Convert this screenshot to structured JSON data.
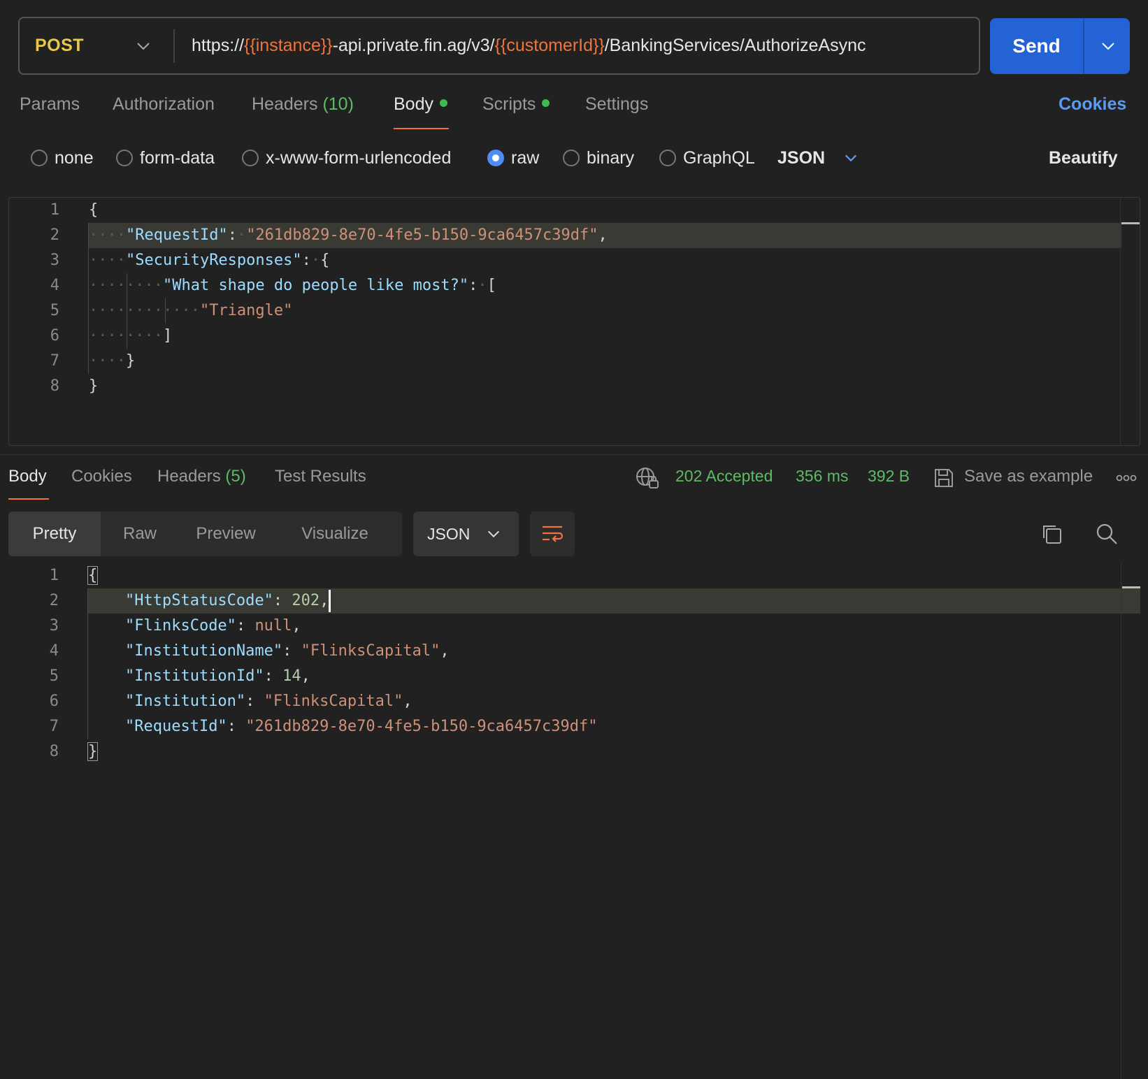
{
  "request": {
    "method": "POST",
    "url_parts": [
      {
        "text": "https://",
        "var": false
      },
      {
        "text": "{{instance}}",
        "var": true
      },
      {
        "text": "-api.private.fin.ag/v3/",
        "var": false
      },
      {
        "text": "{{customerId}}",
        "var": true
      },
      {
        "text": "/BankingServices/AuthorizeAsync",
        "var": false
      }
    ],
    "send_label": "Send"
  },
  "request_tabs": {
    "params": "Params",
    "authorization": "Authorization",
    "headers": "Headers",
    "headers_count": "(10)",
    "body": "Body",
    "scripts": "Scripts",
    "settings": "Settings",
    "cookies": "Cookies"
  },
  "body_types": {
    "none": "none",
    "form_data": "form-data",
    "urlencoded": "x-www-form-urlencoded",
    "raw": "raw",
    "binary": "binary",
    "graphql": "GraphQL",
    "format": "JSON",
    "beautify": "Beautify",
    "selected": "raw"
  },
  "request_body_lines": [
    "1",
    "2",
    "3",
    "4",
    "5",
    "6",
    "7",
    "8"
  ],
  "request_body": {
    "request_id_key": "\"RequestId\"",
    "request_id_val": "\"261db829-8e70-4fe5-b150-9ca6457c39df\"",
    "security_key": "\"SecurityResponses\"",
    "question_key": "\"What shape do people like most?\"",
    "answer": "\"Triangle\""
  },
  "response_tabs": {
    "body": "Body",
    "cookies": "Cookies",
    "headers": "Headers",
    "headers_count": "(5)",
    "test_results": "Test Results"
  },
  "response_status": {
    "status": "202 Accepted",
    "time": "356 ms",
    "size": "392 B",
    "save_example": "Save as example"
  },
  "view_modes": {
    "pretty": "Pretty",
    "raw": "Raw",
    "preview": "Preview",
    "visualize": "Visualize",
    "format": "JSON"
  },
  "response_body": {
    "http_status_key": "\"HttpStatusCode\"",
    "http_status_val": "202",
    "flinks_code_key": "\"FlinksCode\"",
    "flinks_code_val": "null",
    "institution_name_key": "\"InstitutionName\"",
    "institution_name_val": "\"FlinksCapital\"",
    "institution_id_key": "\"InstitutionId\"",
    "institution_id_val": "14",
    "institution_key": "\"Institution\"",
    "institution_val": "\"FlinksCapital\"",
    "request_id_key": "\"RequestId\"",
    "request_id_val": "\"261db829-8e70-4fe5-b150-9ca6457c39df\""
  },
  "colors": {
    "accent_orange": "#f0743c",
    "send_blue": "#2463d6",
    "status_green": "#5dbb63",
    "method_yellow": "#e8c84a"
  }
}
